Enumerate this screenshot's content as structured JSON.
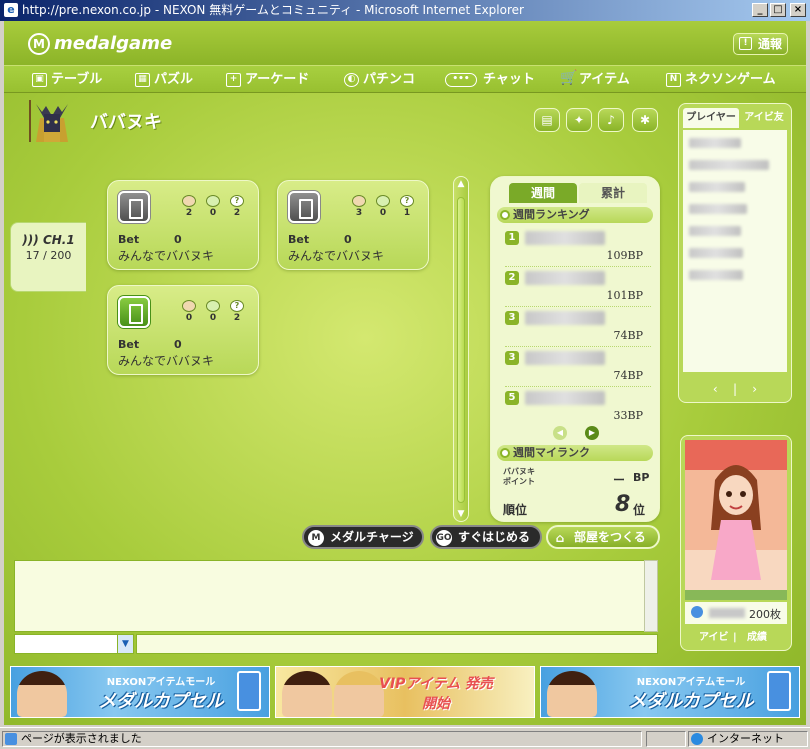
{
  "window": {
    "title": "http://pre.nexon.co.jp - NEXON 無料ゲームとコミュニティ - Microsoft Internet Explorer",
    "min": "_",
    "max": "□",
    "close": "×"
  },
  "header": {
    "logo": "medalgame",
    "logo_mark": "M",
    "notice_label": "通報"
  },
  "nav": [
    {
      "label": "テーブル",
      "icon": "table-icon"
    },
    {
      "label": "パズル",
      "icon": "puzzle-icon"
    },
    {
      "label": "アーケード",
      "icon": "arcade-icon"
    },
    {
      "label": "パチンコ",
      "icon": "pachinko-icon"
    },
    {
      "label": "チャット",
      "icon": "chat-icon"
    },
    {
      "label": "アイテム",
      "icon": "cart-icon"
    },
    {
      "label": "ネクソンゲーム",
      "icon": "nexon-icon"
    }
  ],
  "room_header": {
    "title": "ババヌキ"
  },
  "channel": {
    "name": "CH.1",
    "count": "17 / 200"
  },
  "rooms": [
    {
      "players": [
        "2",
        "0",
        "2"
      ],
      "bet_label": "Bet",
      "bet": "0",
      "name": "みんなでババヌキ",
      "open": false
    },
    {
      "players": [
        "3",
        "0",
        "1"
      ],
      "bet_label": "Bet",
      "bet": "0",
      "name": "みんなでババヌキ",
      "open": false
    },
    {
      "players": [
        "0",
        "0",
        "2"
      ],
      "bet_label": "Bet",
      "bet": "0",
      "name": "みんなでババヌキ",
      "open": true
    }
  ],
  "ranking": {
    "tab_weekly": "週間",
    "tab_total": "累計",
    "weekly_title": "週間ランキング",
    "rows": [
      {
        "rank": "1",
        "bp": "109BP"
      },
      {
        "rank": "2",
        "bp": "101BP"
      },
      {
        "rank": "3",
        "bp": "74BP"
      },
      {
        "rank": "3",
        "bp": "74BP"
      },
      {
        "rank": "5",
        "bp": "33BP"
      }
    ],
    "my_title": "週間マイランク",
    "points_label_1": "ババヌキ",
    "points_label_2": "ポイント",
    "points_value": "ー",
    "points_unit": "BP",
    "position_label": "順位",
    "position_value": "8",
    "position_unit": "位"
  },
  "side": {
    "tab_players": "プレイヤー",
    "tab_friends": "アイビ友"
  },
  "avatar": {
    "medals": "200枚",
    "tab_aibi": "アイビ",
    "tab_record": "成績"
  },
  "actions": {
    "medal_charge": "メダルチャージ",
    "quick_start": "すぐはじめる",
    "create_room": "部屋をつくる"
  },
  "banners": [
    {
      "top": "NEXONアイテムモール",
      "main": "メダルカプセル"
    },
    {
      "top": "",
      "main": "VIPアイテム 発売開始"
    },
    {
      "top": "NEXONアイテムモール",
      "main": "メダルカプセル"
    }
  ],
  "status": {
    "left": "ページが表示されました",
    "zone": "インターネット"
  }
}
